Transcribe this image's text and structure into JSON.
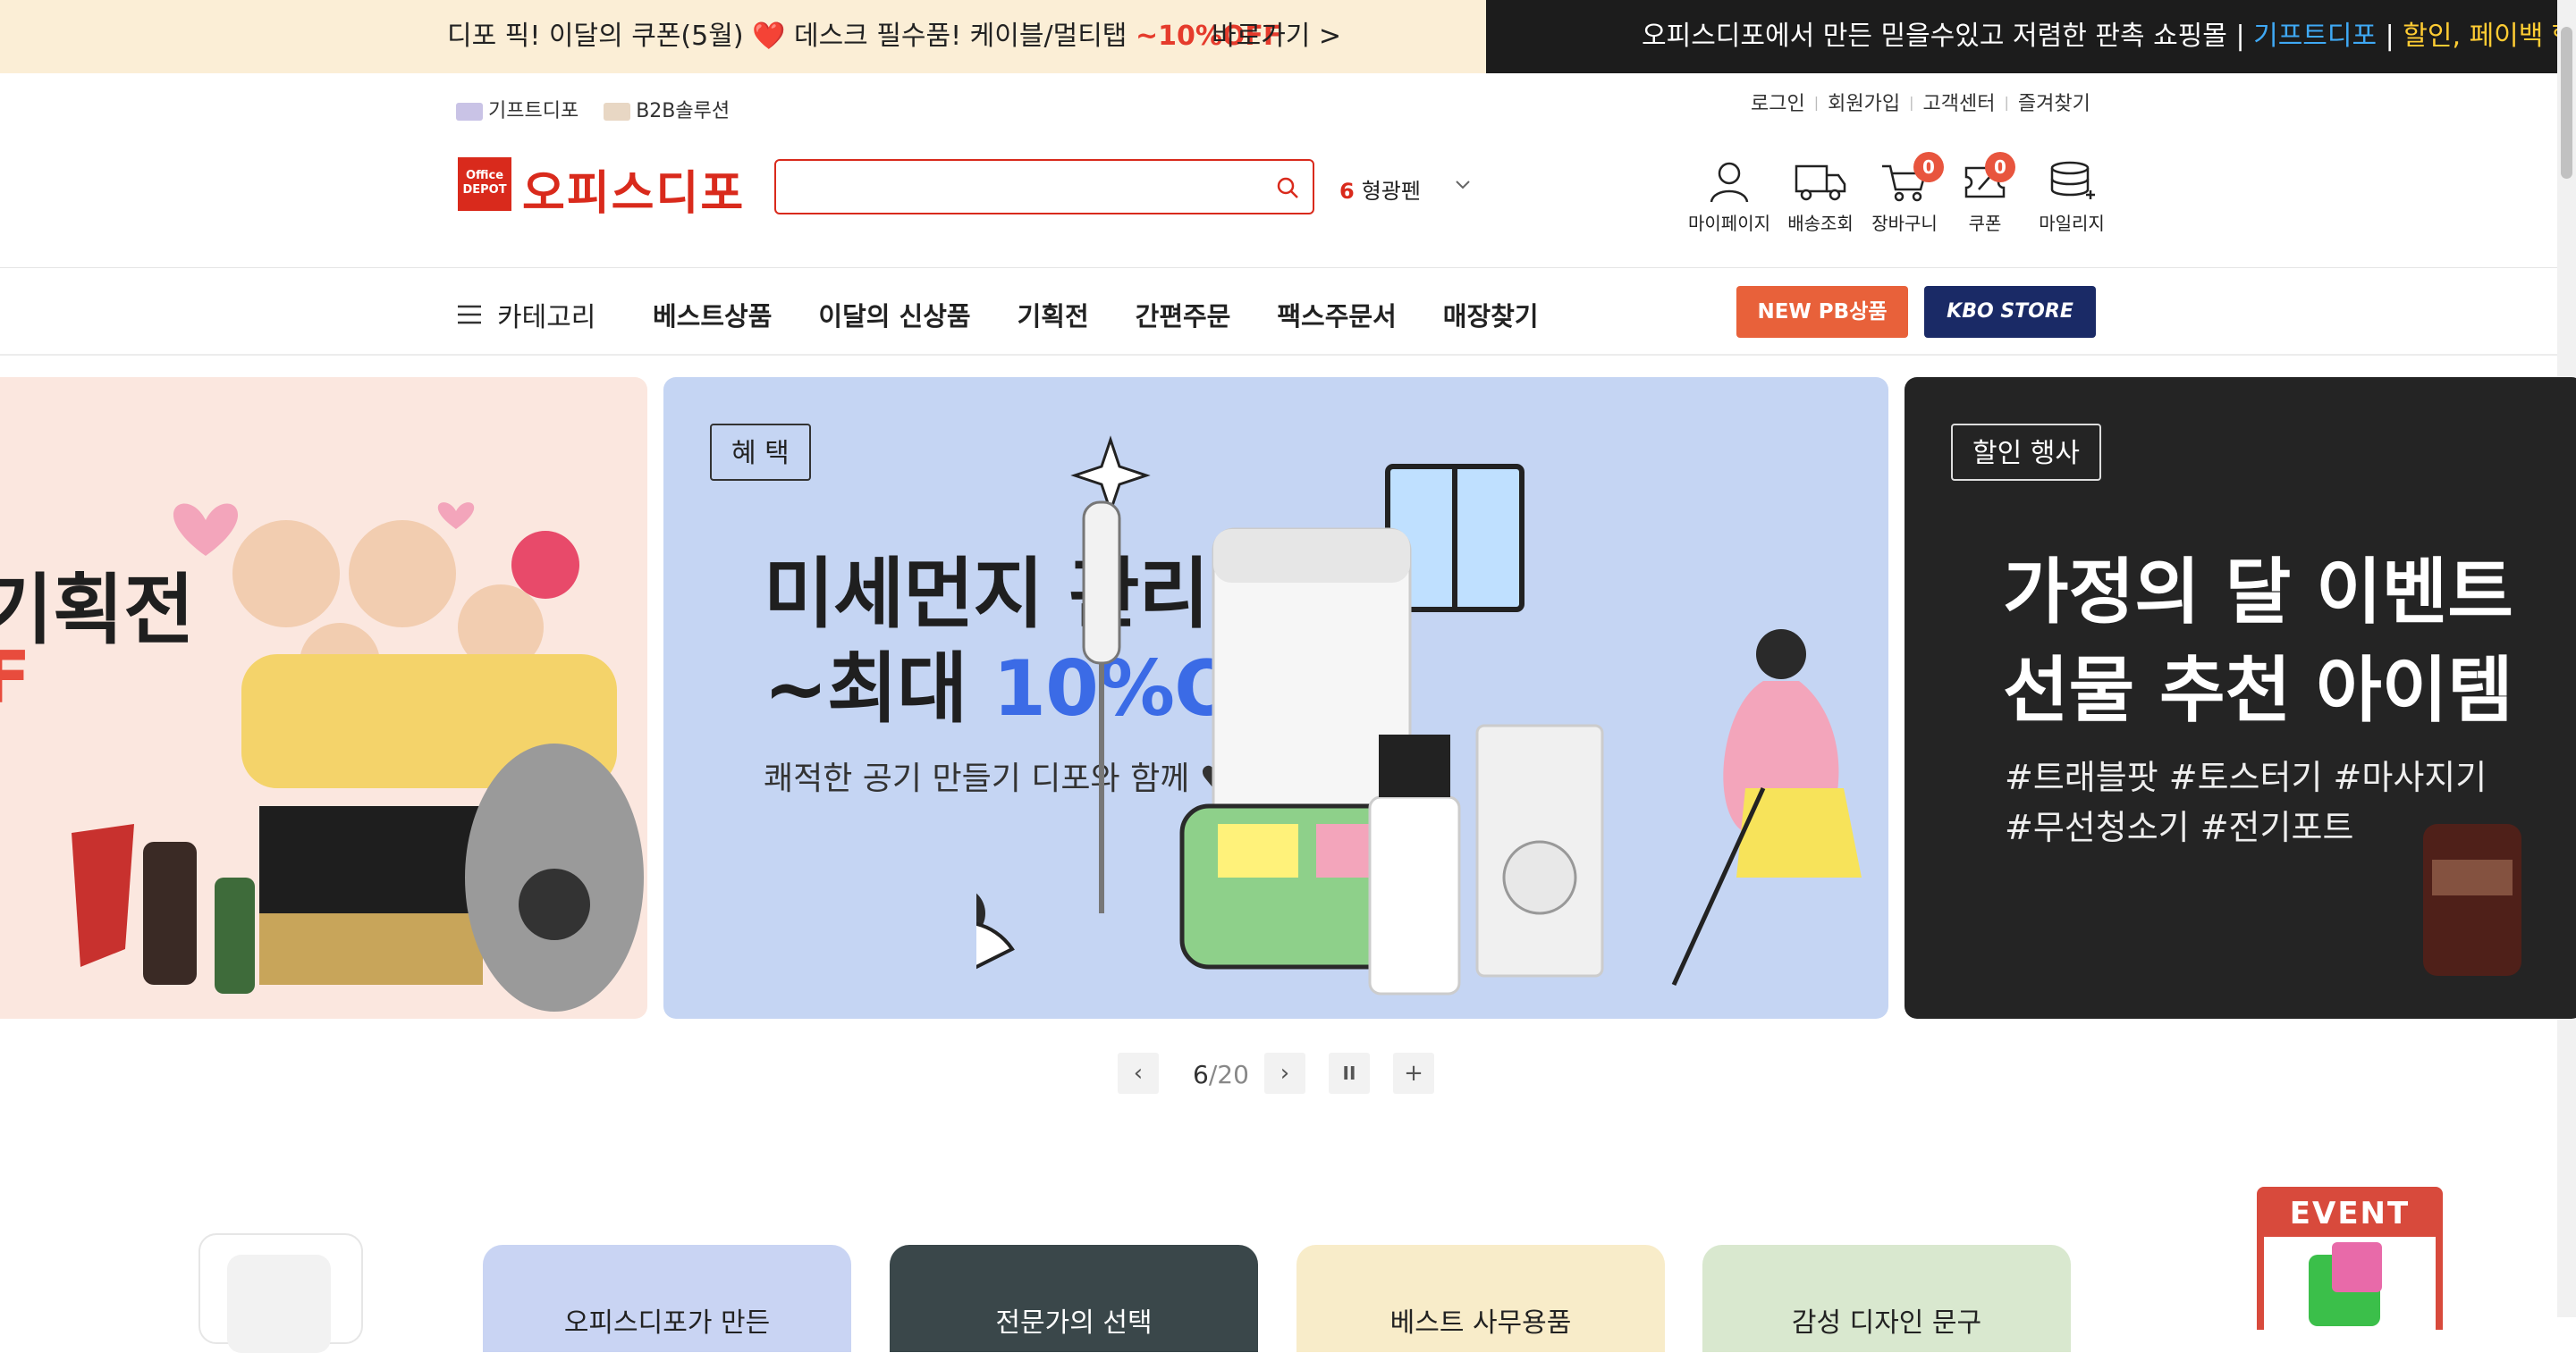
{
  "promo": {
    "left_pre": "디포 픽! 이달의 쿠폰(5월)",
    "left_heart": "❤️",
    "left_mid": "데스크 필수품! 케이블/멀티탭",
    "left_off": "~10%OFF",
    "left_link": "바로가기 >",
    "right_text": "오피스디포에서 만든 믿을수있고 저렴한 판촉 쇼핑몰",
    "right_sep": "|",
    "right_gift": "기프트디포",
    "right_sep2": "|",
    "right_more": "할인, 페이백 행사중"
  },
  "util": {
    "gift": "기프트디포",
    "b2b": "B2B솔루션"
  },
  "member": {
    "login": "로그인",
    "join": "회원가입",
    "cs": "고객센터",
    "fav": "즐겨찾기",
    "sep": "|"
  },
  "logo": {
    "box": "Office DEPOT",
    "text": "오피스디포"
  },
  "search": {
    "placeholder": "",
    "value": ""
  },
  "rank": {
    "num": "6",
    "keyword": "형광펜"
  },
  "header_icons": {
    "mypage": "마이페이지",
    "delivery": "배송조회",
    "cart": "장바구니",
    "cart_count": "0",
    "coupon": "쿠폰",
    "coupon_count": "0",
    "mileage": "마일리지"
  },
  "nav": {
    "category": "카테고리",
    "items": [
      "베스트상품",
      "이달의 신상품",
      "기획전",
      "간편주문",
      "팩스주문서",
      "매장찾기"
    ],
    "pb_button": "NEW PB상품",
    "kbo_button": "KBO STORE"
  },
  "banners": {
    "b1": {
      "title": "기획전",
      "sub": "F"
    },
    "b2": {
      "tag": "혜 택",
      "line1": "미세먼지 관리!",
      "line2_pre": "~최대 ",
      "line2_off": "10%OFF",
      "sub": "쾌적한 공기 만들기 디포와 함께 ♥"
    },
    "b3": {
      "tag": "할인 행사",
      "line1": "가정의 달 이벤트",
      "line2": "선물 추천 아이템",
      "tags1": "#트래블팟 #토스터기 #마사지기",
      "tags2": "#무선청소기 #전기포트"
    }
  },
  "slider": {
    "current": "6",
    "total": "/20",
    "prev": "‹",
    "next": "›",
    "pause": "II",
    "plus": "+"
  },
  "tiles": [
    "오피스디포가 만든",
    "전문가의 선택",
    "베스트 사무용품",
    "감성 디자인 문구"
  ],
  "event": {
    "label": "EVENT"
  },
  "colors": {
    "brand_red": "#d92a1c",
    "promo_bg": "#fbeed6",
    "banner_blue": "#c5d5f3",
    "kbo_navy": "#1a2a66",
    "pb_orange": "#e8613a"
  }
}
